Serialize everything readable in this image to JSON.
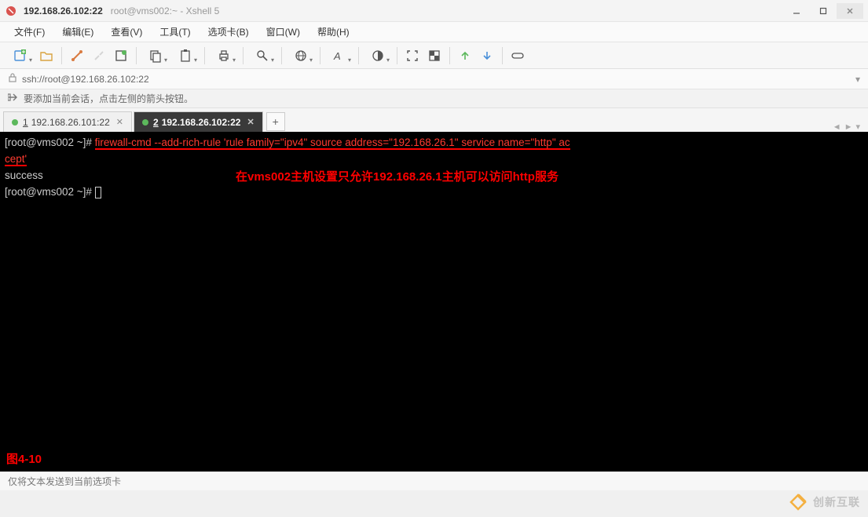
{
  "titlebar": {
    "primary": "192.168.26.102:22",
    "secondary": "root@vms002:~ - Xshell 5"
  },
  "menubar": {
    "items": [
      "文件(F)",
      "编辑(E)",
      "查看(V)",
      "工具(T)",
      "选项卡(B)",
      "窗口(W)",
      "帮助(H)"
    ]
  },
  "addressbar": {
    "url": "ssh://root@192.168.26.102:22"
  },
  "hintbar": {
    "text": "要添加当前会话，点击左侧的箭头按钮。"
  },
  "tabs": {
    "items": [
      {
        "num": "1",
        "label": "192.168.26.101:22",
        "active": false
      },
      {
        "num": "2",
        "label": "192.168.26.102:22",
        "active": true
      }
    ],
    "add": "+"
  },
  "terminal": {
    "prompt1_user": "[root@vms002 ~]",
    "prompt1_hash": "# ",
    "cmd_part1": "firewall-cmd --add-rich-rule 'rule family=\"ipv4\" source address=\"192.168.26.1\" service name=\"http\" ac",
    "cmd_part2": "cept'",
    "success": "success",
    "prompt2_user": "[root@vms002 ~]",
    "prompt2_hash": "# ",
    "annotation": "在vms002主机设置只允许192.168.26.1主机可以访问http服务",
    "figure_label": "图4-10"
  },
  "statusbar": {
    "text": "仅将文本发送到当前选项卡"
  },
  "watermark": {
    "text": "创新互联"
  }
}
